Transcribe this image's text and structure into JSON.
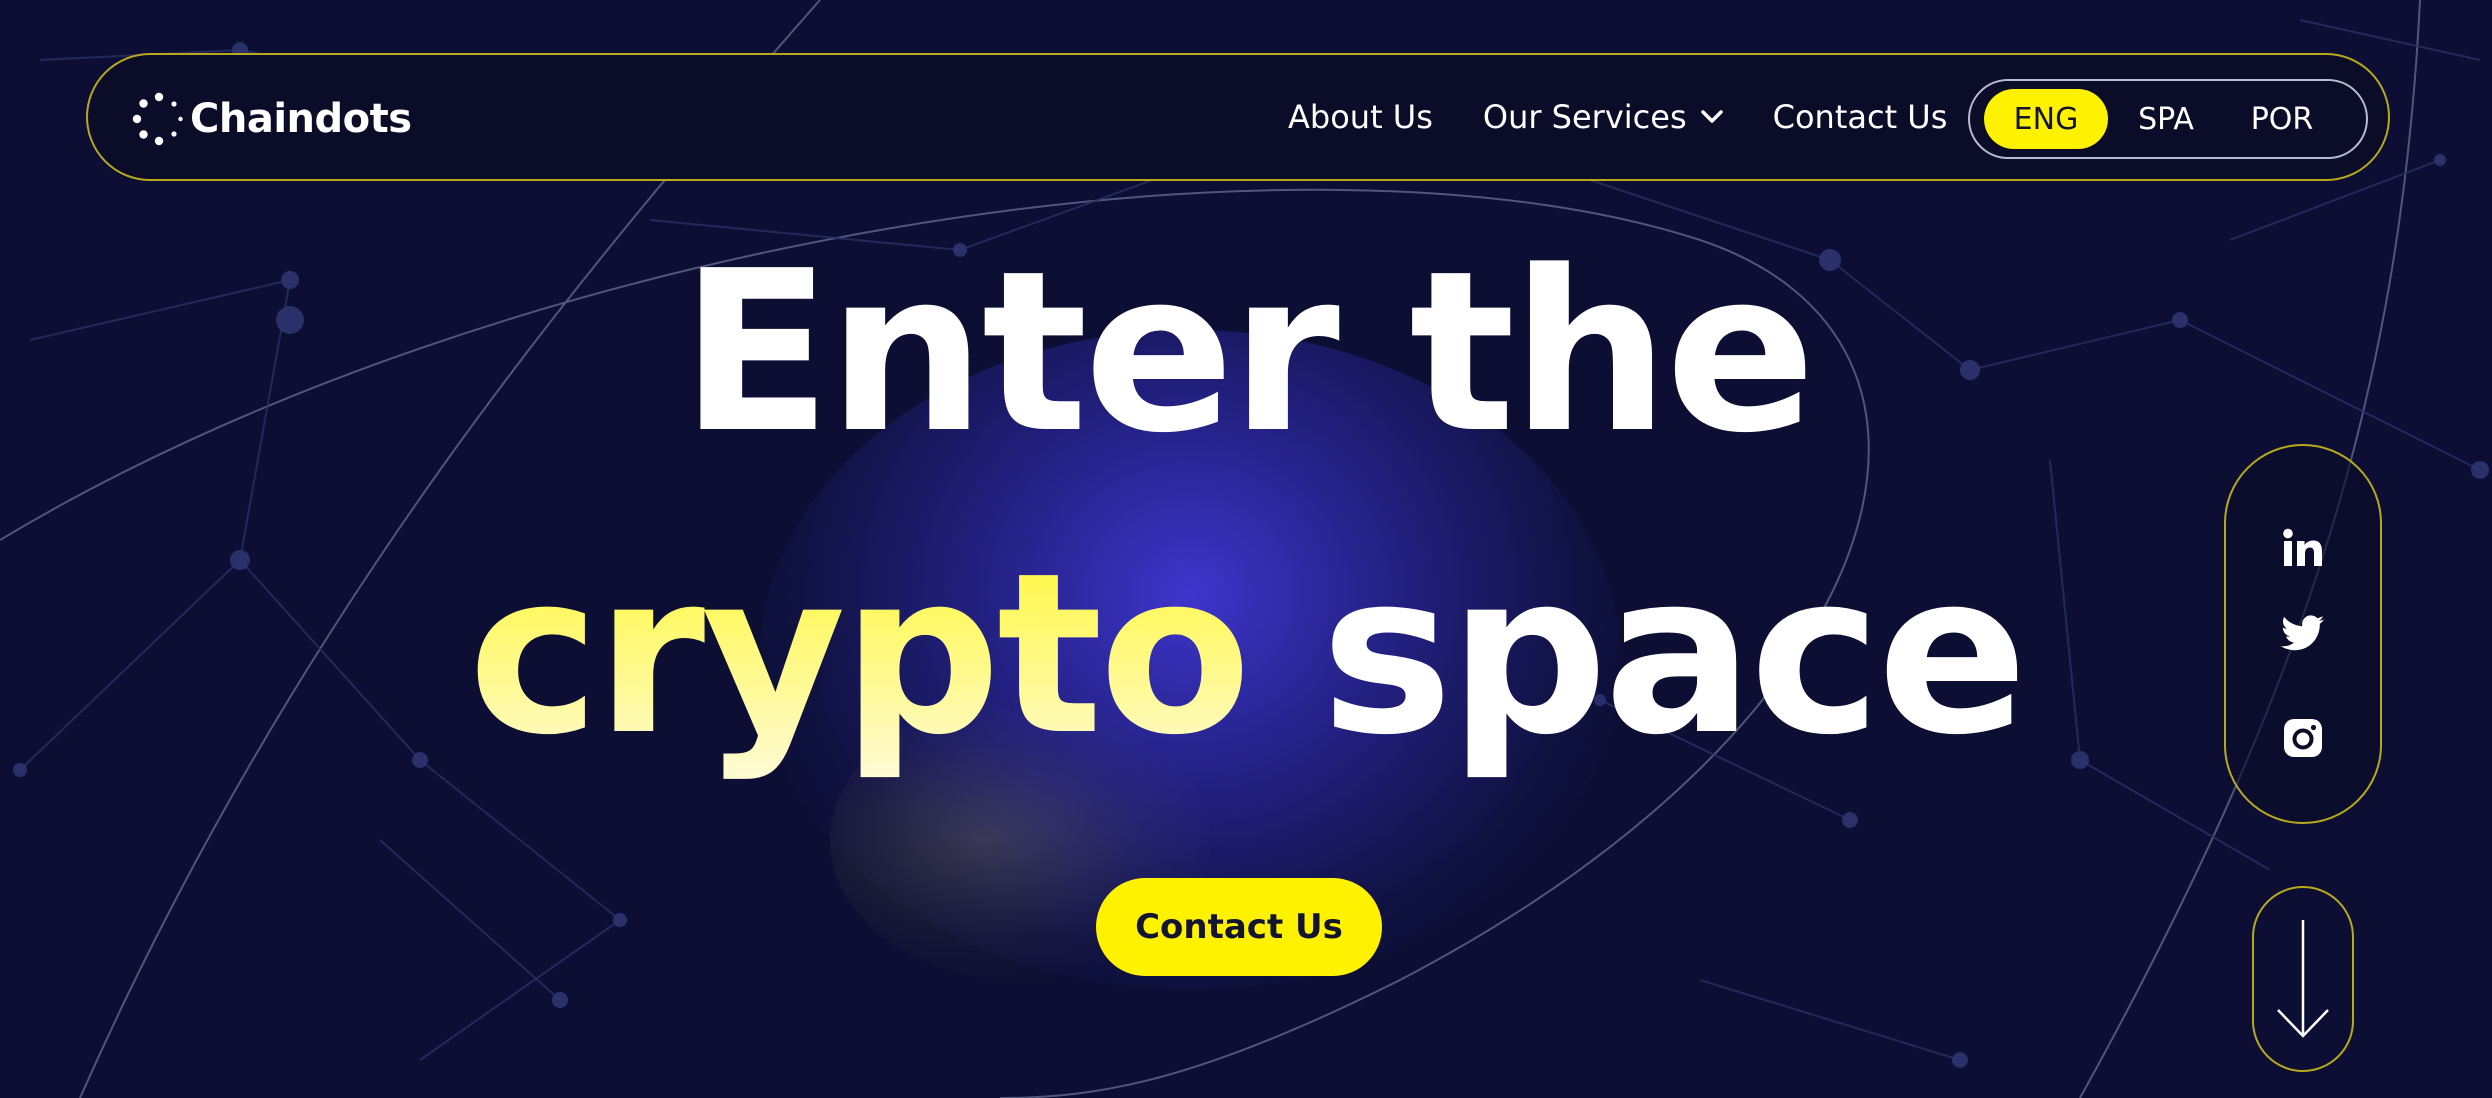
{
  "brand": {
    "name": "Chaindots"
  },
  "nav": {
    "links": [
      {
        "label": "About Us"
      },
      {
        "label": "Our Services"
      },
      {
        "label": "Contact Us"
      }
    ],
    "languages": [
      {
        "code": "ENG",
        "active": true
      },
      {
        "code": "SPA",
        "active": false
      },
      {
        "code": "POR",
        "active": false
      }
    ]
  },
  "hero": {
    "line1": "Enter the",
    "highlight": "crypto",
    "line2_rest": "space",
    "cta_label": "Contact Us"
  },
  "social": {
    "icons": [
      "linkedin-icon",
      "twitter-icon",
      "instagram-icon"
    ]
  },
  "scroll": {
    "icon": "arrow-down-icon"
  },
  "colors": {
    "background": "#0c0f33",
    "accent": "#fff200",
    "border_gold": "#b8a81c",
    "glow": "#463ce6"
  }
}
